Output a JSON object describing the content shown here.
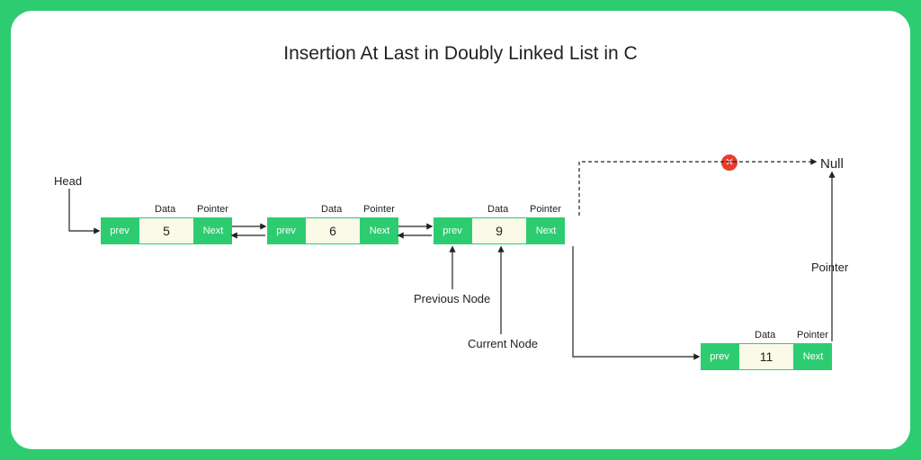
{
  "title": "Insertion At Last in Doubly Linked List in C",
  "labels": {
    "head": "Head",
    "data": "Data",
    "pointer": "Pointer",
    "prev": "prev",
    "next": "Next",
    "null": "Null",
    "previous_node": "Previous Node",
    "current_node": "Current Node",
    "pointer_side": "Pointer"
  },
  "nodes": [
    {
      "value": "5"
    },
    {
      "value": "6"
    },
    {
      "value": "9"
    },
    {
      "value": "11"
    }
  ],
  "colors": {
    "accent": "#2ecc71",
    "error": "#e63d2e",
    "data_bg": "#fbfae8"
  }
}
